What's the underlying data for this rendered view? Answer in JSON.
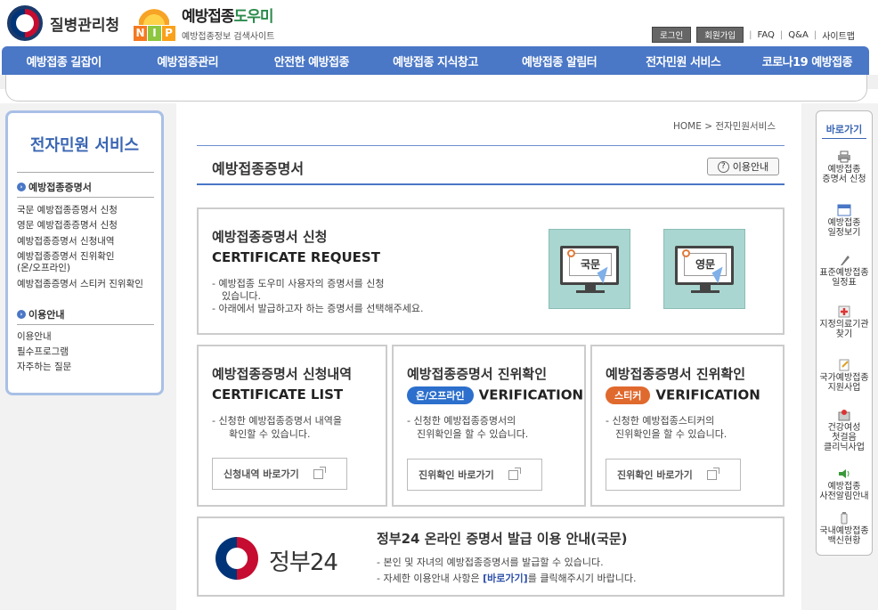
{
  "header": {
    "kdca_name": "질병관리청",
    "nip_badge": [
      "N",
      "I",
      "P"
    ],
    "nip_title_a": "예방접종",
    "nip_title_b": "도우미",
    "nip_subtitle": "예방접종정보 검색사이트",
    "login": "로그인",
    "join": "회원가입",
    "faq": "FAQ",
    "qna": "Q&A",
    "sitemap": "사이트맵",
    "sep": "|"
  },
  "nav": [
    "예방접종 길잡이",
    "예방접종관리",
    "안전한 예방접종",
    "예방접종 지식창고",
    "예방접종 알림터",
    "전자민원 서비스",
    "코로나19 예방접종"
  ],
  "lnb": {
    "title": "전자민원 서비스",
    "section1": "예방접종증명서",
    "links1": [
      "국문 예방접종증명서 신청",
      "영문 예방접종증명서 신청",
      "예방접종증명서 신청내역",
      "예방접종증명서 진위확인",
      "(온/오프라인)",
      "예방접종증명서 스티커 진위확인"
    ],
    "section2": "이용안내",
    "links2": [
      "이용안내",
      "필수프로그램",
      "자주하는 질문"
    ]
  },
  "breadcrumb": {
    "home": "HOME",
    "arrow": ">",
    "current": "전자민원서비스"
  },
  "page_title": "예방접종증명서",
  "guide_button": "이용안내",
  "request": {
    "title": "예방접종증명서 신청",
    "title_en": "CERTIFICATE REQUEST",
    "desc1": "- 예방접종 도우미 사용자의 증명서를 신청",
    "desc1b": "있습니다.",
    "desc2": "- 아래에서 발급하고자 하는 증명서를 선택해주세요.",
    "korean": "국문",
    "english": "영문"
  },
  "list": {
    "title": "예방접종증명서 신청내역",
    "title_en": "CERTIFICATE LIST",
    "desc1": "- 신청한 예방접종증명서 내역을",
    "desc2": "확인할 수 있습니다.",
    "link": "신청내역 바로가기"
  },
  "verify_online": {
    "title": "예방접종증명서 진위확인",
    "pill": "온/오프라인",
    "pill_color": "#2c6fcc",
    "title_en": "VERIFICATION",
    "desc1": "- 신청한 예방접종증명서의",
    "desc2": "진위확인을 할 수 있습니다.",
    "link": "진위확인 바로가기"
  },
  "verify_sticker": {
    "title": "예방접종증명서 진위확인",
    "pill": "스티커",
    "pill_color": "#e0692e",
    "title_en": "VERIFICATION",
    "desc1": "- 신청한 예방접종스티커의",
    "desc2": "진위확인을 할 수 있습니다.",
    "link": "진위확인 바로가기"
  },
  "gov24": {
    "logo_text": "정부24",
    "title": "정부24 온라인 증명서 발급 이용 안내(국문)",
    "desc1": "- 본인 및 자녀의 예방접종증명서를 발급할 수 있습니다.",
    "desc2a": "- 자세한 이용안내 사항은 ",
    "desc2link": "[바로가기]",
    "desc2b": "를 클릭해주시기 바랍니다."
  },
  "quick": {
    "title": "바로가기",
    "items": [
      {
        "label": "예방접종\n증명서 신청",
        "icon": "printer-icon"
      },
      {
        "label": "예방접종\n일정보기",
        "icon": "calendar-icon"
      },
      {
        "label": "표준예방접종\n일정표",
        "icon": "pen-icon"
      },
      {
        "label": "지정의료기관\n찾기",
        "icon": "hospital-icon"
      },
      {
        "label": "국가예방접종\n지원사업",
        "icon": "document-icon"
      },
      {
        "label": "건강여성\n첫걸음\n클리닉사업",
        "icon": "box-icon"
      },
      {
        "label": "예방접종\n사전알림안내",
        "icon": "speaker-icon"
      },
      {
        "label": "국내예방접종\n백신현황",
        "icon": "vaccine-icon"
      }
    ]
  }
}
